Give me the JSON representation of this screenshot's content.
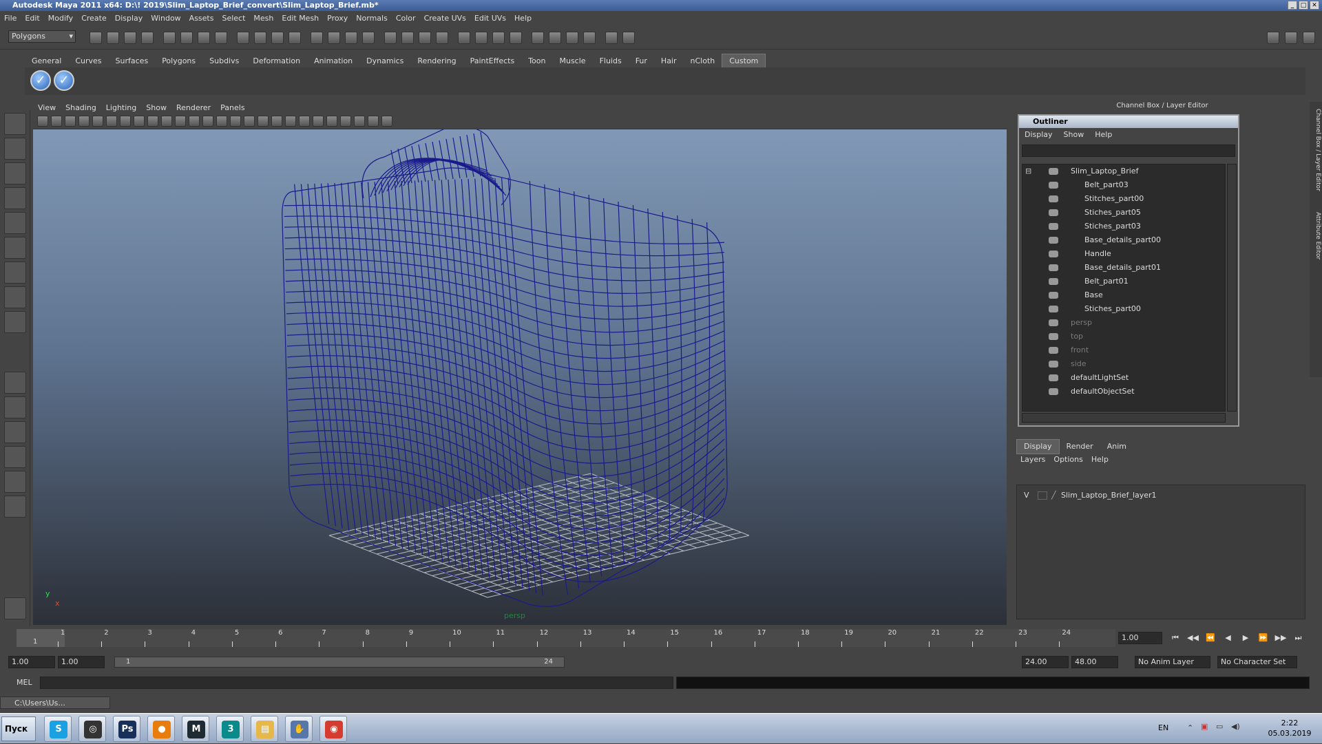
{
  "window": {
    "title": "Autodesk Maya 2011 x64: D:\\! 2019\\Slim_Laptop_Brief_convert\\Slim_Laptop_Brief.mb*"
  },
  "menu": [
    "File",
    "Edit",
    "Modify",
    "Create",
    "Display",
    "Window",
    "Assets",
    "Select",
    "Mesh",
    "Edit Mesh",
    "Proxy",
    "Normals",
    "Color",
    "Create UVs",
    "Edit UVs",
    "Help"
  ],
  "mode_select": "Polygons",
  "shelf": {
    "tabs": [
      "General",
      "Curves",
      "Surfaces",
      "Polygons",
      "Subdivs",
      "Deformation",
      "Animation",
      "Dynamics",
      "Rendering",
      "PaintEffects",
      "Toon",
      "Muscle",
      "Fluids",
      "Fur",
      "Hair",
      "nCloth",
      "Custom"
    ],
    "active_tab": "Custom",
    "buttons": [
      "✓",
      "✓"
    ]
  },
  "viewport": {
    "menu": [
      "View",
      "Shading",
      "Lighting",
      "Show",
      "Renderer",
      "Panels"
    ],
    "camera_label": "persp",
    "axis": {
      "y": "y",
      "x": "x"
    },
    "wire_color": "#1a1a8c"
  },
  "channel_box_header": "Channel Box / Layer Editor",
  "outliner": {
    "title": "Outliner",
    "menu": [
      "Display",
      "Show",
      "Help"
    ],
    "root": "Slim_Laptop_Brief",
    "children": [
      "Belt_part03",
      "Stitches_part00",
      "Stiches_part05",
      "Stiches_part03",
      "Base_details_part00",
      "Handle",
      "Base_details_part01",
      "Belt_part01",
      "Base",
      "Stiches_part00"
    ],
    "cameras": [
      "persp",
      "top",
      "front",
      "side"
    ],
    "sets": [
      "defaultLightSet",
      "defaultObjectSet"
    ]
  },
  "layer_editor": {
    "tabs": [
      "Display",
      "Render",
      "Anim"
    ],
    "active_tab": "Display",
    "menu": [
      "Layers",
      "Options",
      "Help"
    ],
    "layer": {
      "visible": "V",
      "name": "Slim_Laptop_Brief_layer1"
    }
  },
  "side_tabs": [
    "Channel Box / Layer Editor",
    "Attribute Editor"
  ],
  "time": {
    "frames": [
      "1",
      "2",
      "3",
      "4",
      "5",
      "6",
      "7",
      "8",
      "9",
      "10",
      "11",
      "12",
      "13",
      "14",
      "15",
      "16",
      "17",
      "18",
      "19",
      "20",
      "21",
      "22",
      "23",
      "24"
    ],
    "current_marker": "1",
    "current_frame": "1.00",
    "range_start": "1.00",
    "playback_start": "1.00",
    "slider_start": "1",
    "slider_end": "24",
    "playback_end": "24.00",
    "range_end": "48.00",
    "anim_layer": "No Anim Layer",
    "character_set": "No Character Set"
  },
  "command_line": {
    "label": "MEL"
  },
  "help_line": "C:\\Users\\Us...",
  "taskbar": {
    "start": "Пуск",
    "apps": [
      {
        "name": "skype",
        "glyph": "S",
        "color": "#1ba1e2"
      },
      {
        "name": "app-2",
        "glyph": "◎",
        "color": "#333333"
      },
      {
        "name": "photoshop",
        "glyph": "Ps",
        "color": "#16305a"
      },
      {
        "name": "blender",
        "glyph": "●",
        "color": "#e87d0d"
      },
      {
        "name": "maya",
        "glyph": "M",
        "color": "#1e2b33"
      },
      {
        "name": "3dsmax",
        "glyph": "3",
        "color": "#0a8a8a"
      },
      {
        "name": "explorer",
        "glyph": "▤",
        "color": "#e6b84a"
      },
      {
        "name": "app-8",
        "glyph": "✋",
        "color": "#5577aa"
      },
      {
        "name": "chrome",
        "glyph": "◉",
        "color": "#d63b2f"
      }
    ],
    "lang": "EN",
    "time": "2:22",
    "date": "05.03.2019"
  }
}
